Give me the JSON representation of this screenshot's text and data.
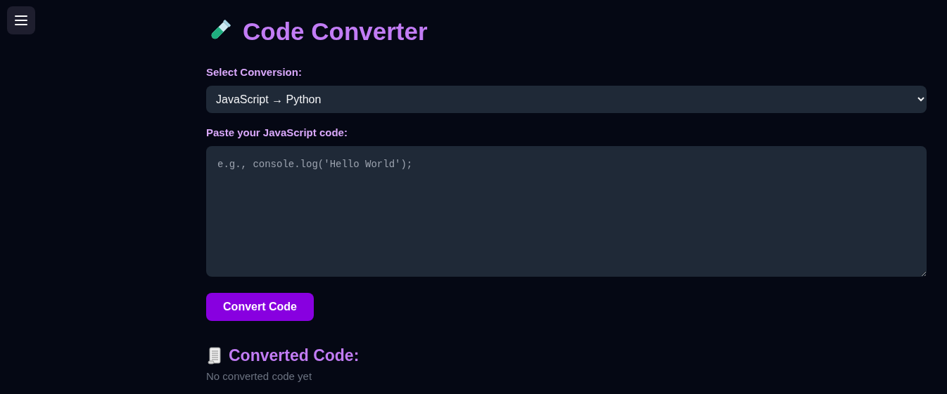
{
  "title": "Code Converter",
  "conversion": {
    "label": "Select Conversion:",
    "value": "JavaScript → Python"
  },
  "input": {
    "label": "Paste your JavaScript code:",
    "placeholder": "e.g., console.log('Hello World');"
  },
  "convert_button": "Convert Code",
  "output": {
    "heading": "Converted Code:",
    "empty_text": "No converted code yet"
  }
}
